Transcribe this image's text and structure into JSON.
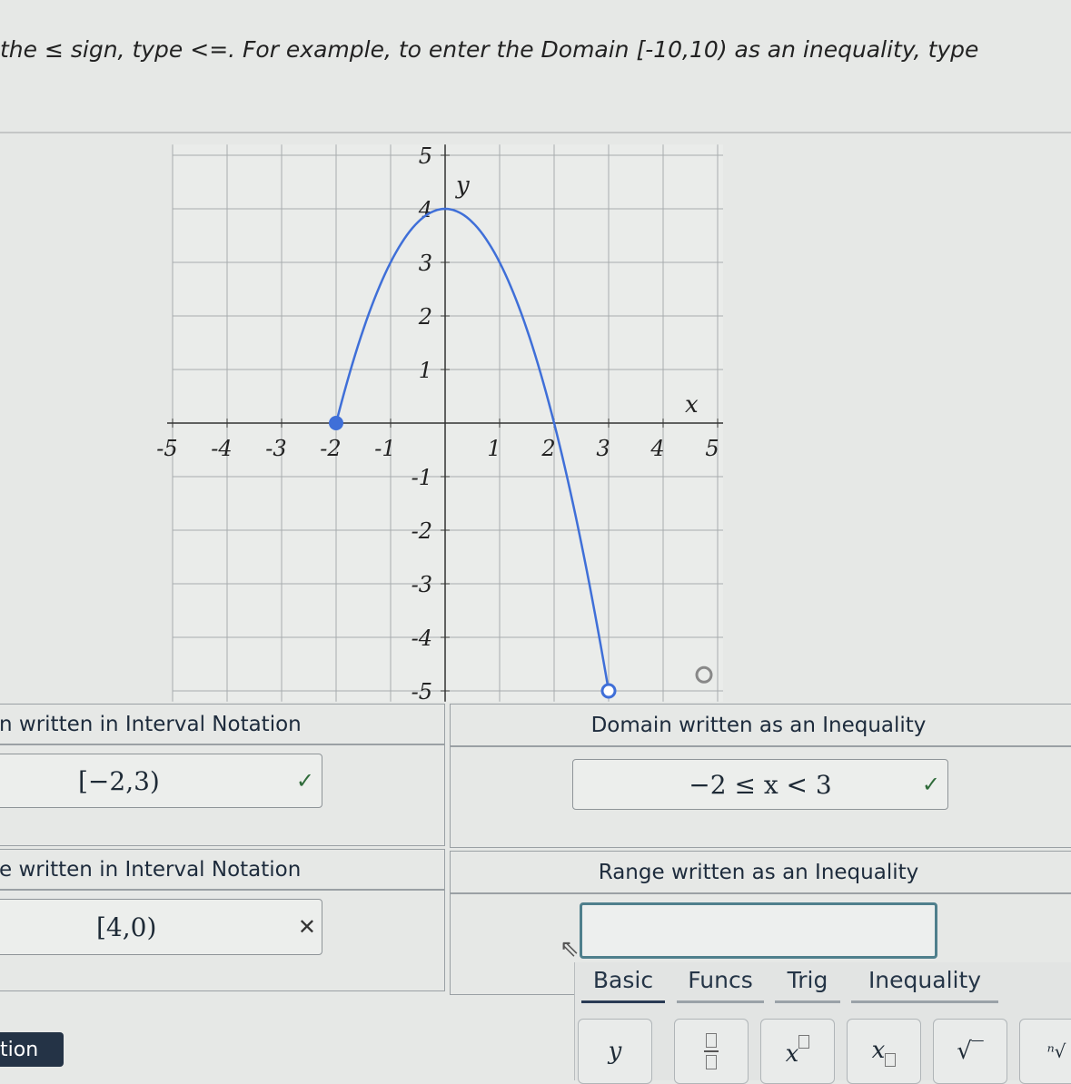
{
  "instructions": "the ≤ sign, type <=. For example, to enter the Domain [-10,10) as an inequality, type",
  "graph": {
    "x_label": "x",
    "y_label": "y",
    "x_ticks": [
      "-5",
      "-4",
      "-3",
      "-2",
      "-1",
      "1",
      "2",
      "3",
      "4",
      "5"
    ],
    "y_ticks": [
      "5",
      "4",
      "3",
      "2",
      "1",
      "-1",
      "-2",
      "-3",
      "-4",
      "-5"
    ],
    "curve_color": "#3f6fd8",
    "start_point": {
      "x": -2,
      "y": 0,
      "closed": true
    },
    "end_point": {
      "x": 3,
      "y": -5,
      "closed": false
    },
    "vertex": {
      "x": 0,
      "y": 4
    }
  },
  "table": {
    "domain_interval_header": "n written in Interval Notation",
    "domain_inequality_header": "Domain written as an Inequality",
    "domain_interval_value": "[−2,3)",
    "domain_interval_status": "✓",
    "domain_inequality_value": "−2 ≤ x < 3",
    "domain_inequality_status": "✓",
    "range_interval_header": "e written in Interval Notation",
    "range_inequality_header": "Range written as an Inequality",
    "range_interval_value": "[4,0)",
    "range_interval_status": "✕",
    "range_inequality_value": ""
  },
  "keyboard": {
    "tabs": [
      "Basic",
      "Funcs",
      "Trig",
      "Inequality"
    ],
    "active_tab": "Basic",
    "keys": [
      "y",
      "fraction",
      "x^□",
      "x_□",
      "√",
      "n√"
    ]
  },
  "bottom_button": "tion"
}
